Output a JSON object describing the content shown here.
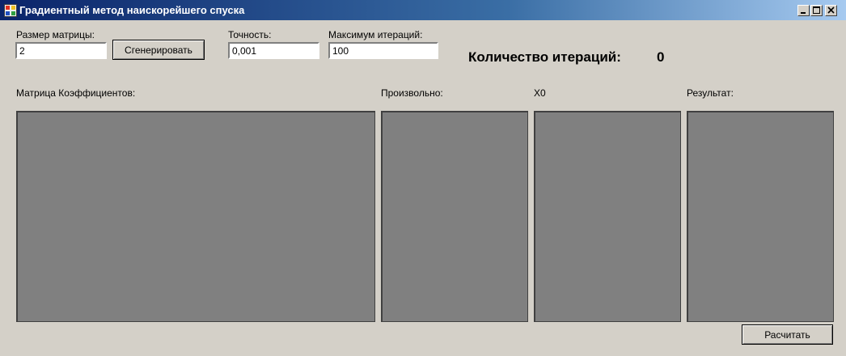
{
  "window": {
    "title": "Градиентный метод наискорейшего спуска",
    "icon": "app-window-icon",
    "controls": [
      "minimize-icon",
      "maximize-icon",
      "close-icon"
    ]
  },
  "inputs": {
    "matrix_size": {
      "label": "Размер матрицы:",
      "value": "2"
    },
    "precision": {
      "label": "Точность:",
      "value": "0,001"
    },
    "max_iterations": {
      "label": "Максимум итераций:",
      "value": "100"
    }
  },
  "buttons": {
    "generate": "Сгенерировать",
    "calculate": "Расчитать"
  },
  "iterations": {
    "label": "Количество итераций:",
    "value": "0"
  },
  "grids": {
    "coefficients": "Матрица Коэффициентов:",
    "arbitrary": "Произвольно:",
    "x0": "X0",
    "result": "Результат:"
  },
  "colors": {
    "form_background": "#d4d0c8",
    "grid_background": "#808080",
    "titlebar_start": "#0a246a",
    "titlebar_end": "#a6caf0"
  }
}
